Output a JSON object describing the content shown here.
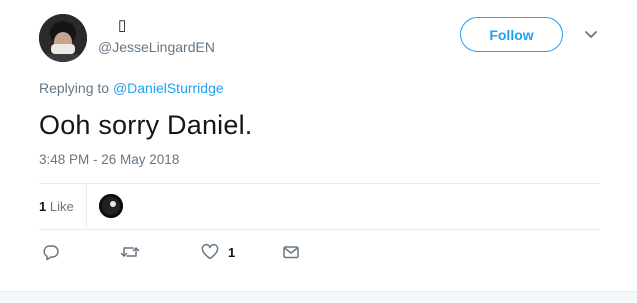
{
  "tweet": {
    "author": {
      "name": "",
      "name_glyph": "▯",
      "handle": "@JesseLingardEN"
    },
    "follow_label": "Follow",
    "replying_prefix": "Replying to",
    "replying_to": "@DanielSturridge",
    "text": "Ooh sorry Daniel.",
    "timestamp": "3:48 PM - 26 May 2018",
    "stats": {
      "like_count": "1",
      "like_label": "Like"
    },
    "actions": {
      "reply_count": "",
      "retweet_count": "",
      "like_count": "1"
    }
  },
  "colors": {
    "accent": "#1da1f2",
    "secondary_text": "#657786",
    "divider": "#e6ecf0"
  },
  "icons": {
    "reply": "reply-icon",
    "retweet": "retweet-icon",
    "like": "heart-icon",
    "dm": "envelope-icon",
    "caret": "chevron-down-icon"
  }
}
